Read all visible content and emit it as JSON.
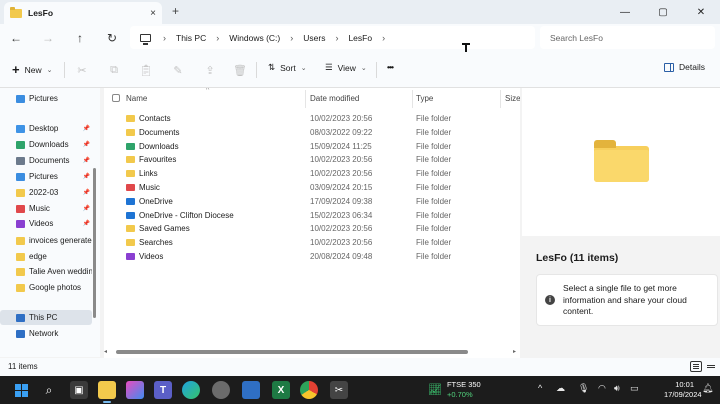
{
  "window": {
    "tab_title": "LesFo",
    "tab_close": "×",
    "new_tab": "+",
    "controls": {
      "minimize": "—",
      "maximize": "▢",
      "close": "✕"
    }
  },
  "navigation": {
    "back": "←",
    "forward": "→",
    "up": "↑",
    "refresh": "↻",
    "breadcrumbs": [
      "This PC",
      "Windows (C:)",
      "Users",
      "LesFo"
    ],
    "separator": "›",
    "search_placeholder": "Search LesFo"
  },
  "commandbar": {
    "new_label": "New",
    "new_plus": "+",
    "sort_label": "Sort",
    "view_label": "View",
    "more": "•••",
    "details_label": "Details",
    "chevron": "⌄",
    "icons": [
      "cut-icon",
      "copy-icon",
      "paste-icon",
      "rename-icon",
      "share-icon",
      "delete-icon",
      "sort-icon",
      "view-icon"
    ]
  },
  "sidebar": {
    "items": [
      {
        "label": "Pictures",
        "color": "#3b8de0",
        "pinned": false
      },
      {
        "label": "Desktop",
        "color": "#3f93e6",
        "pinned": true
      },
      {
        "label": "Downloads",
        "color": "#2ea36a",
        "pinned": true
      },
      {
        "label": "Documents",
        "color": "#6c7a8c",
        "pinned": true
      },
      {
        "label": "Pictures",
        "color": "#3b8de0",
        "pinned": true
      },
      {
        "label": "2022-03",
        "color": "#f2c94c",
        "pinned": true
      },
      {
        "label": "Music",
        "color": "#e0484b",
        "pinned": true
      },
      {
        "label": "Videos",
        "color": "#8a3fd1",
        "pinned": true
      },
      {
        "label": "invoices generate",
        "color": "#f2c94c",
        "pinned": false
      },
      {
        "label": "edge",
        "color": "#f2c94c",
        "pinned": false
      },
      {
        "label": "Talie Aven weddin",
        "color": "#f2c94c",
        "pinned": false
      },
      {
        "label": "Google photos",
        "color": "#f2c94c",
        "pinned": false
      },
      {
        "label": "This PC",
        "color": "#2f6fc4",
        "pinned": false,
        "selected": true
      },
      {
        "label": "Network",
        "color": "#2f6fc4",
        "pinned": false
      }
    ],
    "pin_glyph": "📌"
  },
  "columns": {
    "name": "Name",
    "date": "Date modified",
    "type": "Type",
    "size": "Size",
    "sort_caret": "^"
  },
  "files": [
    {
      "name": "Contacts",
      "date": "10/02/2023 20:56",
      "type": "File folder",
      "color": "#f2c94c"
    },
    {
      "name": "Documents",
      "date": "08/03/2022 09:22",
      "type": "File folder",
      "color": "#f2c94c"
    },
    {
      "name": "Downloads",
      "date": "15/09/2024 11:25",
      "type": "File folder",
      "color": "#2ea36a"
    },
    {
      "name": "Favourites",
      "date": "10/02/2023 20:56",
      "type": "File folder",
      "color": "#f2c94c"
    },
    {
      "name": "Links",
      "date": "10/02/2023 20:56",
      "type": "File folder",
      "color": "#f2c94c"
    },
    {
      "name": "Music",
      "date": "03/09/2024 20:15",
      "type": "File folder",
      "color": "#e0484b"
    },
    {
      "name": "OneDrive",
      "date": "17/09/2024 09:38",
      "type": "File folder",
      "color": "#1e74d4"
    },
    {
      "name": "OneDrive - Clifton Diocese",
      "date": "15/02/2023 06:34",
      "type": "File folder",
      "color": "#1e74d4"
    },
    {
      "name": "Saved Games",
      "date": "10/02/2023 20:56",
      "type": "File folder",
      "color": "#f2c94c"
    },
    {
      "name": "Searches",
      "date": "10/02/2023 20:56",
      "type": "File folder",
      "color": "#f2c94c"
    },
    {
      "name": "Videos",
      "date": "20/08/2024 09:48",
      "type": "File folder",
      "color": "#8a3fd1"
    }
  ],
  "details_pane": {
    "title": "LesFo (11 items)",
    "info_glyph": "i",
    "info_text": "Select a single file to get more information and share your cloud content."
  },
  "status": {
    "item_count": "11 items"
  },
  "taskbar": {
    "stock_name": "FTSE 350",
    "stock_change": "+0.70%",
    "time": "10:01",
    "date": "17/09/2024",
    "tray_chevron": "^",
    "tray_icons": [
      "cloud-icon",
      "microphone-icon",
      "wifi-icon",
      "speaker-icon",
      "battery-icon"
    ]
  }
}
